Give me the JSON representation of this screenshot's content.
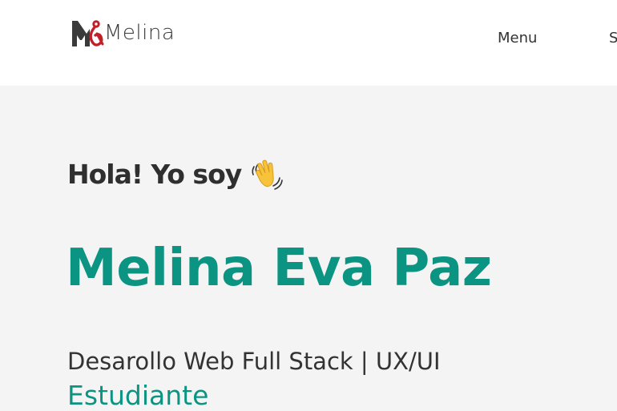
{
  "header": {
    "logo_text": "Melina",
    "nav": {
      "menu_label": "Menu",
      "next_label": "S"
    }
  },
  "hero": {
    "greeting": "Hola! Yo soy",
    "name": "Melina Eva Paz",
    "role": "Desarollo Web Full Stack | UX/UI",
    "status": "Estudiante"
  },
  "icons": {
    "logo": "monogram-logo-icon",
    "greeting": "waving-hand-icon"
  },
  "colors": {
    "accent": "#0b9482",
    "logo_red": "#c0202a",
    "text_dark": "#333333",
    "header_bg": "#ffffff",
    "page_bg": "#f4f4f4"
  }
}
